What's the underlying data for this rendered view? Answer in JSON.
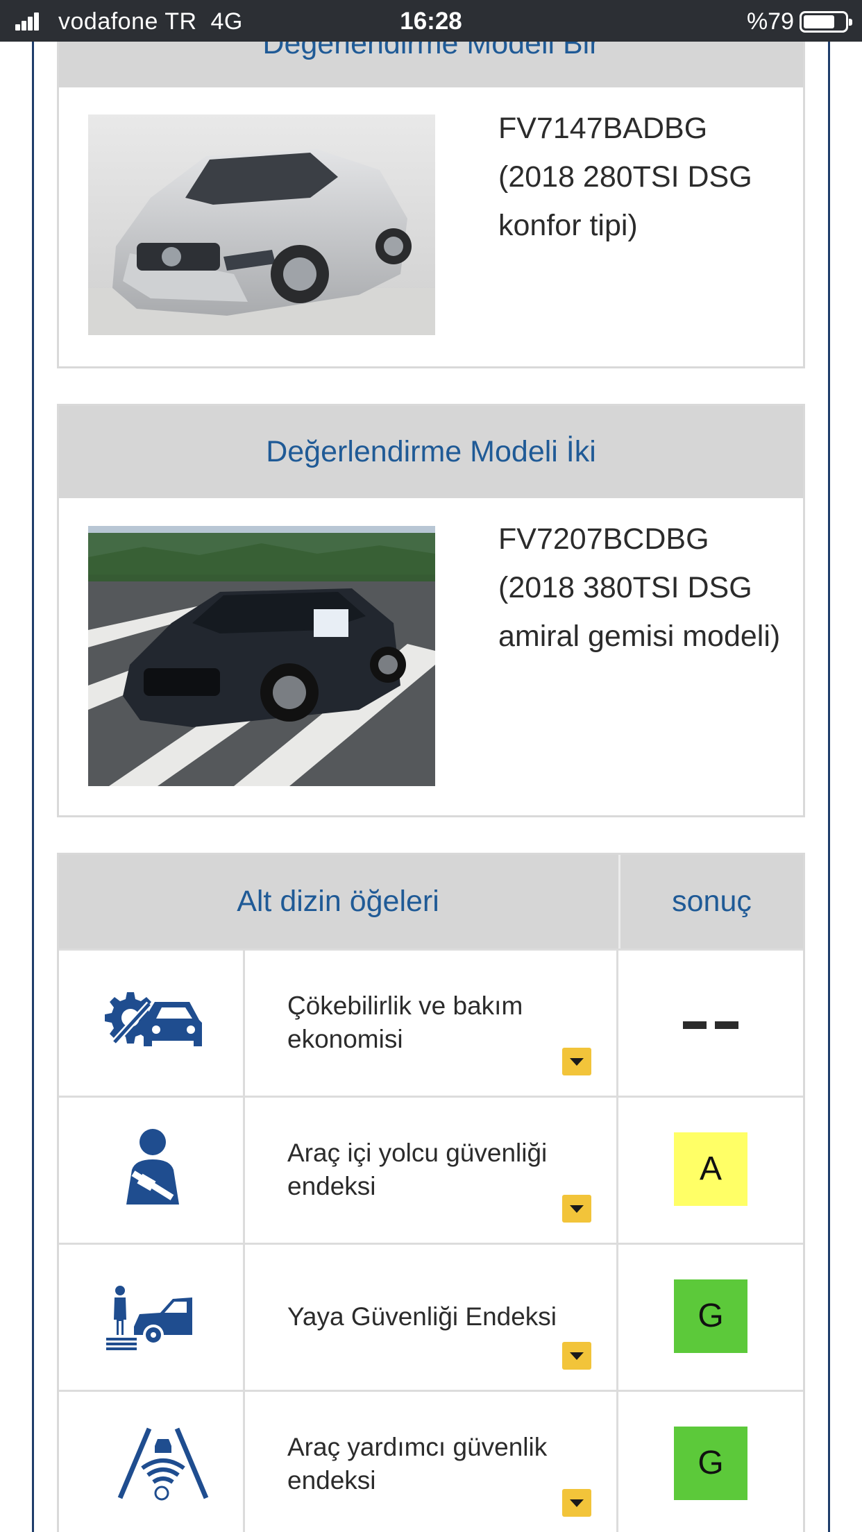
{
  "status_bar": {
    "carrier": "vodafone TR",
    "network": "4G",
    "time": "16:28",
    "battery": "%79"
  },
  "models": [
    {
      "title": "Değerlendirme Modeli Bir",
      "photo": "silver-sedan",
      "description": "FV7147BADBG (2018 280TSI DSG konfor tipi)"
    },
    {
      "title": "Değerlendirme Modeli İki",
      "photo": "dark-sedan",
      "description": "FV7207BCDBG (2018 380TSI DSG amiral gemisi modeli)"
    }
  ],
  "table": {
    "header_items": "Alt dizin öğeleri",
    "header_result": "sonuç",
    "rows": [
      {
        "icon": "car-repair-icon",
        "label": "Çökebilirlik ve bakım ekonomisi",
        "result": "--",
        "result_color": ""
      },
      {
        "icon": "seatbelt-occupant-icon",
        "label": "Araç içi yolcu güvenliği endeksi",
        "result": "A",
        "result_color": "#ffff66"
      },
      {
        "icon": "pedestrian-car-icon",
        "label": "Yaya Güvenliği Endeksi",
        "result": "G",
        "result_color": "#5cc93a"
      },
      {
        "icon": "lane-assist-icon",
        "label": "Araç yardımcı güvenlik endeksi",
        "result": "G",
        "result_color": "#5cc93a"
      }
    ]
  },
  "colors": {
    "accent_text": "#1f5a96",
    "header_bg": "#d6d6d6",
    "icon_blue": "#1f4d8f",
    "dropdown": "#f2c43a"
  }
}
